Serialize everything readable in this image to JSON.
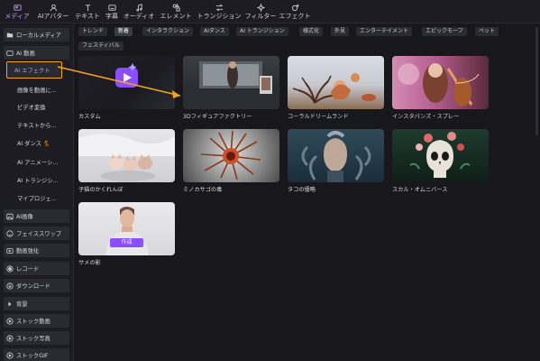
{
  "toolbar": {
    "items": [
      {
        "label": "メディア",
        "icon": "media-icon",
        "active": true
      },
      {
        "label": "AIアバター",
        "icon": "avatar-icon"
      },
      {
        "label": "テキスト",
        "icon": "text-icon"
      },
      {
        "label": "字幕",
        "icon": "subtitle-icon"
      },
      {
        "label": "オーディオ",
        "icon": "audio-icon"
      },
      {
        "label": "エレメント",
        "icon": "element-icon"
      },
      {
        "label": "トランジション",
        "icon": "transition-icon"
      },
      {
        "label": "フィルター",
        "icon": "filter-icon"
      },
      {
        "label": "エフェクト",
        "icon": "effect-icon"
      }
    ]
  },
  "sidebar": {
    "local_media": "ローカルメディア",
    "ai_video": "AI 動画",
    "ai_effect": "AI エフェクト",
    "image_to_video": "画像を動画に...",
    "video_convert": "ビデオ変換",
    "text_to": "テキストから...",
    "ai_dance": "AI ダンス 💃",
    "ai_anime": "AI アニメーシ...",
    "ai_transition": "AI トランジシ...",
    "my_project": "マイプロジェ...",
    "ai_image": "AI画像",
    "face_swap": "フェイススワップ",
    "video_enhance": "動画強化",
    "record": "レコード",
    "download": "ダウンロード",
    "background": "背景",
    "stock_video": "ストック動画",
    "stock_photo": "ストック写真",
    "stock_gif": "ストックGIF"
  },
  "tags": [
    {
      "label": "トレンド"
    },
    {
      "label": "新着",
      "active": true
    },
    {
      "label": "インタラクション"
    },
    {
      "label": "AIダンス"
    },
    {
      "label": "AI トランジション"
    },
    {
      "label": "様式化"
    },
    {
      "label": "外見"
    },
    {
      "label": "エンターテイメント"
    },
    {
      "label": "エピックモーフ"
    },
    {
      "label": "ペット"
    },
    {
      "label": "フェスティバル"
    }
  ],
  "cards": [
    {
      "caption": "カスタム"
    },
    {
      "caption": "3Dフィギュアファクトリー"
    },
    {
      "caption": "コーラルドリームランド"
    },
    {
      "caption": "インスタパンズ・スプレー"
    },
    {
      "caption": "子猫のかくれんぼ"
    },
    {
      "caption": "ミノカサゴの毒"
    },
    {
      "caption": "タコの優略"
    },
    {
      "caption": "スカル・オムニバース"
    },
    {
      "caption": "サメの影",
      "button": "作成"
    }
  ],
  "colors": {
    "accent": "#8a4dff",
    "highlight": "#f5a417",
    "bg": "#17171c"
  }
}
